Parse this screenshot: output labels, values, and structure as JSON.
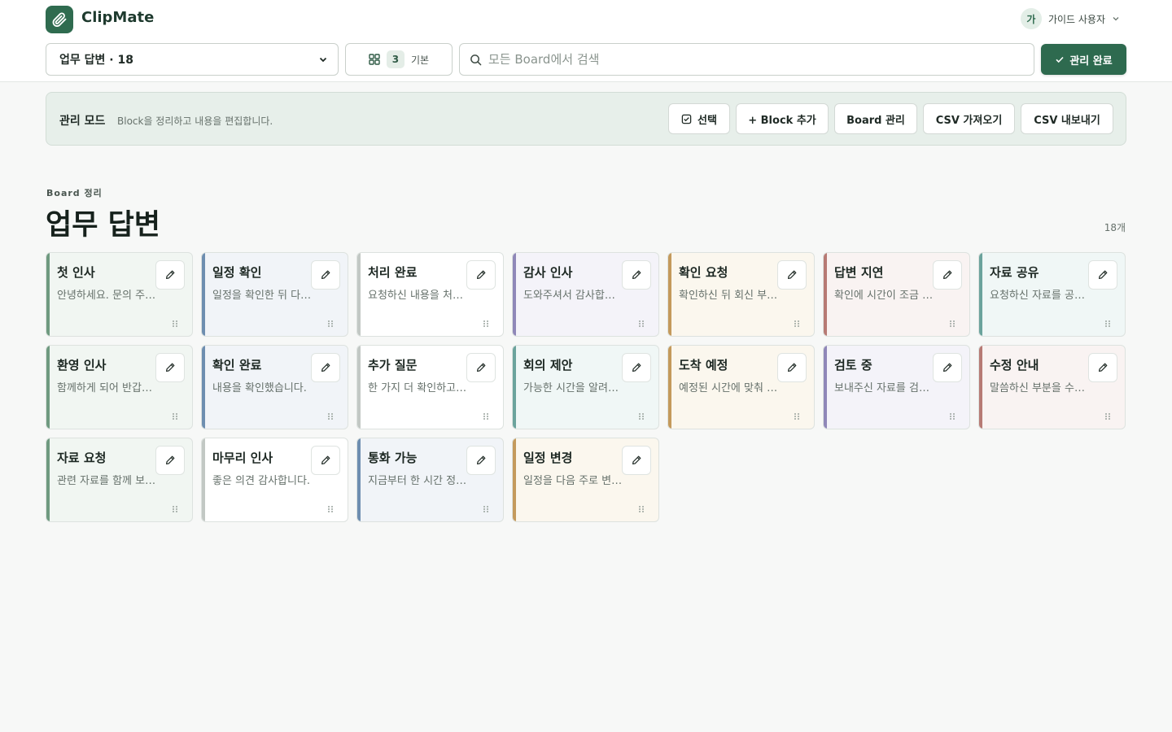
{
  "app": {
    "title": "ClipMate"
  },
  "user": {
    "avatar": "가",
    "name": "가이드 사용자"
  },
  "toolbar": {
    "board_select": "업무 답변 · 18",
    "layout_count": "3",
    "layout_label": "기본",
    "search_placeholder": "모든 Board에서 검색",
    "done_label": "관리 완료"
  },
  "manage": {
    "title": "관리 모드",
    "description": "Block을 정리하고 내용을 편집합니다.",
    "select_label": "선택",
    "add_block_label": "+ Block 추가",
    "board_manage_label": "Board 관리",
    "csv_import_label": "CSV 가져오기",
    "csv_export_label": "CSV 내보내기"
  },
  "section": {
    "eyebrow": "Board 정리",
    "title": "업무 답변",
    "count": "18개"
  },
  "colors": {
    "accent": "#2e6a4f",
    "green": "#6f9a80",
    "blue": "#6e8eb0",
    "gray": "#c2c8c4",
    "purple": "#8f87b8",
    "orange": "#c49a5c",
    "red": "#b77a74",
    "teal": "#6ba39c"
  },
  "cards": [
    {
      "title": "첫 인사",
      "desc": "안녕하세요. 문의 주셔서 감사합니다.",
      "color": "green"
    },
    {
      "title": "일정 확인",
      "desc": "일정을 확인한 뒤 다시 연락드리겠습니다.",
      "color": "blue"
    },
    {
      "title": "처리 완료",
      "desc": "요청하신 내용을 처리했습니다.",
      "color": "gray"
    },
    {
      "title": "감사 인사",
      "desc": "도와주셔서 감사합니다.",
      "color": "purple"
    },
    {
      "title": "확인 요청",
      "desc": "확인하신 뒤 회신 부탁드립니다.",
      "color": "orange"
    },
    {
      "title": "답변 지연",
      "desc": "확인에 시간이 조금 걸리고 있습니다.",
      "color": "red"
    },
    {
      "title": "자료 공유",
      "desc": "요청하신 자료를 공유드립니다.",
      "color": "teal"
    },
    {
      "title": "환영 인사",
      "desc": "함께하게 되어 반갑습니다.",
      "color": "green"
    },
    {
      "title": "확인 완료",
      "desc": "내용을 확인했습니다.",
      "color": "blue"
    },
    {
      "title": "추가 질문",
      "desc": "한 가지 더 확인하고 싶습니다.",
      "color": "gray"
    },
    {
      "title": "회의 제안",
      "desc": "가능한 시간을 알려주세요.",
      "color": "teal"
    },
    {
      "title": "도착 예정",
      "desc": "예정된 시간에 맞춰 도착하겠습니다.",
      "color": "orange"
    },
    {
      "title": "검토 중",
      "desc": "보내주신 자료를 검토하고 있습니다.",
      "color": "purple"
    },
    {
      "title": "수정 안내",
      "desc": "말씀하신 부분을 수정했습니다.",
      "color": "red"
    },
    {
      "title": "자료 요청",
      "desc": "관련 자료를 함께 보내주세요.",
      "color": "green"
    },
    {
      "title": "마무리 인사",
      "desc": "좋은 의견 감사합니다.",
      "color": "gray"
    },
    {
      "title": "통화 가능",
      "desc": "지금부터 한 시간 정도 통화 가능합니다.",
      "color": "blue"
    },
    {
      "title": "일정 변경",
      "desc": "일정을 다음 주로 변경하고 싶습니다.",
      "color": "orange"
    }
  ]
}
